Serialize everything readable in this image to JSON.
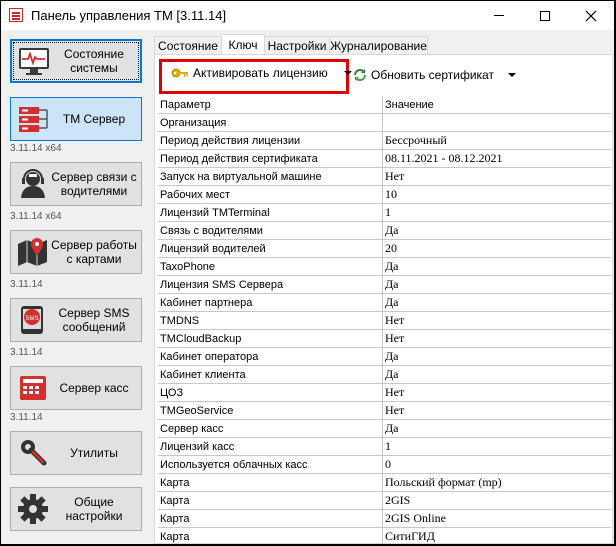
{
  "window": {
    "title": "Панель управления TM [3.11.14]",
    "accent": "#0078d7",
    "highlight_color": "#e00000"
  },
  "sidebar": {
    "items": [
      {
        "label": "Состояние системы",
        "icon": "monitor-pulse-icon",
        "version": ""
      },
      {
        "label": "TM Сервер",
        "icon": "server-rack-icon",
        "version": "3.11.14 x64"
      },
      {
        "label": "Сервер связи с водителями",
        "icon": "driver-headset-icon",
        "version": "3.11.14 x64"
      },
      {
        "label": "Сервер работы с картами",
        "icon": "map-pin-icon",
        "version": "3.11.14"
      },
      {
        "label": "Сервер SMS сообщений",
        "icon": "sms-bubble-icon",
        "version": "3.11.14"
      },
      {
        "label": "Сервер касс",
        "icon": "cash-register-icon",
        "version": "3.11.14"
      },
      {
        "label": "Утилиты",
        "icon": "wrench-icon",
        "version": ""
      },
      {
        "label": "Общие настройки",
        "icon": "gear-icon",
        "version": ""
      }
    ]
  },
  "tabs": [
    "Состояние",
    "Ключ",
    "Настройки",
    "Журналирование"
  ],
  "active_tab": "Ключ",
  "toolbar": {
    "activate_label": "Активировать лицензию",
    "refresh_label": "Обновить сертификат"
  },
  "table": {
    "columns": [
      "Параметр",
      "Значение"
    ],
    "rows": [
      [
        "Организация",
        ""
      ],
      [
        "Период действия лицензии",
        "Бессрочный"
      ],
      [
        "Период действия сертификата",
        "08.11.2021 - 08.12.2021"
      ],
      [
        "Запуск на виртуальной машине",
        "Нет"
      ],
      [
        "Рабочих мест",
        "10"
      ],
      [
        "Лицензий TMTerminal",
        "1"
      ],
      [
        "Связь с водителями",
        "Да"
      ],
      [
        "Лицензий водителей",
        "20"
      ],
      [
        "TaxoPhone",
        "Да"
      ],
      [
        "Лицензия SMS Сервера",
        "Да"
      ],
      [
        "Кабинет партнера",
        "Да"
      ],
      [
        "TMDNS",
        "Нет"
      ],
      [
        "TMCloudBackup",
        "Нет"
      ],
      [
        "Кабинет оператора",
        "Да"
      ],
      [
        "Кабинет клиента",
        "Да"
      ],
      [
        "ЦОЗ",
        "Нет"
      ],
      [
        "TMGeoService",
        "Нет"
      ],
      [
        "Сервер касс",
        "Да"
      ],
      [
        "Лицензий касс",
        "1"
      ],
      [
        "Используется облачных касс",
        "0"
      ],
      [
        "Карта",
        "Польский формат (mp)"
      ],
      [
        "Карта",
        "2GIS"
      ],
      [
        "Карта",
        "2GIS Online"
      ],
      [
        "Карта",
        "СитиГИД"
      ]
    ]
  }
}
